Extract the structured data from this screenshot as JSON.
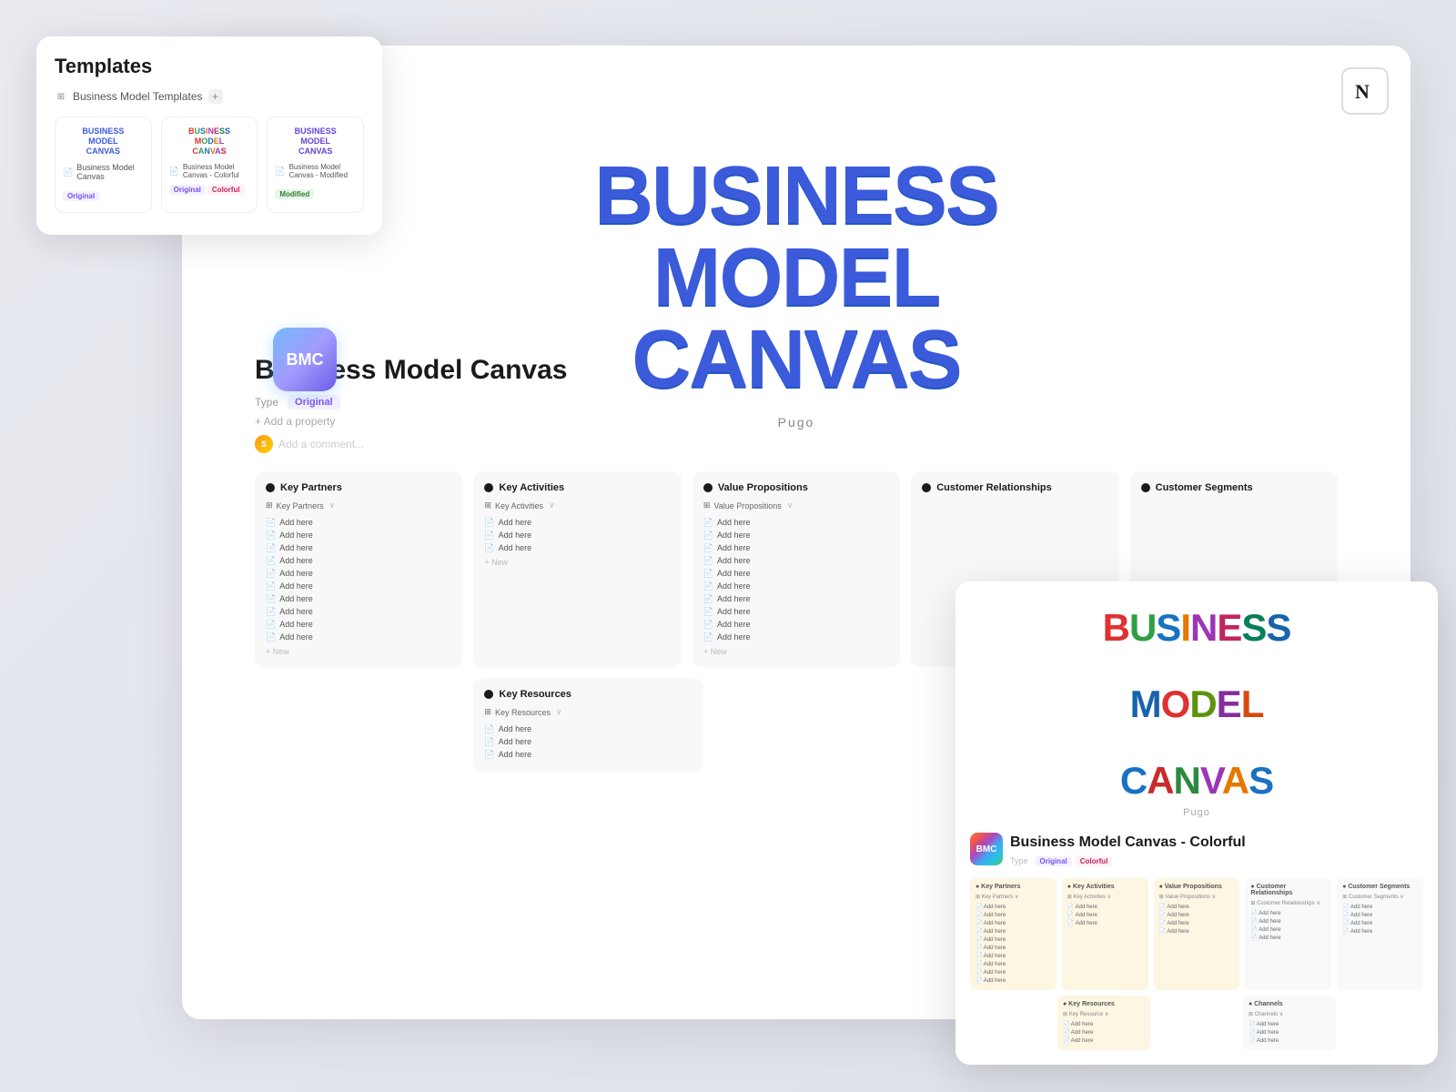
{
  "templates_panel": {
    "title": "Templates",
    "breadcrumb": {
      "icon": "⊞",
      "text": "Business Model Templates",
      "plus": "+"
    },
    "cards": [
      {
        "id": "original",
        "title_lines": [
          "BUSINESS",
          "MODEL",
          "CANVAS"
        ],
        "title_class": "title-original",
        "name": "Business Model Canvas",
        "badge": "Original",
        "badge_class": "badge-original"
      },
      {
        "id": "colorful",
        "title_lines": [
          "BUSINESS",
          "MODEL",
          "CANVAS"
        ],
        "title_class": "title-colorful",
        "name": "Business Model Canvas - Colorful",
        "badge1": "Original",
        "badge1_class": "badge-original",
        "badge2": "Colorful",
        "badge2_class": "badge-colorful"
      },
      {
        "id": "modified",
        "title_lines": [
          "BUSINESS",
          "MODEL",
          "CANVAS"
        ],
        "title_class": "title-modified",
        "name": "Business Model Canvas - Modified",
        "badge": "Modified",
        "badge_class": "badge-modified"
      }
    ]
  },
  "hero": {
    "title_line1": "BUSINESS",
    "title_line2": "MODEL",
    "title_line3": "CANVAS",
    "author": "Pugo"
  },
  "page": {
    "bmc_icon_text": "BMC",
    "title": "Business Model Canvas",
    "property_label": "Type",
    "property_value": "Original",
    "add_property": "+ Add a property",
    "add_comment": "Add a comment...",
    "sections": [
      {
        "title": "Key Partners",
        "db_label": "Key Partners",
        "items": [
          "Add here",
          "Add here",
          "Add here",
          "Add here",
          "Add here",
          "Add here",
          "Add here",
          "Add here",
          "Add here",
          "Add here"
        ]
      },
      {
        "title": "Key Activities",
        "db_label": "Key Activities",
        "items": [
          "Add here",
          "Add here",
          "Add here"
        ]
      },
      {
        "title": "Value Propositions",
        "db_label": "Value Propositions",
        "items": [
          "Add here",
          "Add here",
          "Add here",
          "Add here",
          "Add here",
          "Add here",
          "Add here",
          "Add here",
          "Add here",
          "Add here"
        ]
      },
      {
        "title": "Customer Relationships",
        "db_label": "Customer Relationships",
        "items": []
      },
      {
        "title": "Customer Segments",
        "db_label": "Customer Segments",
        "items": []
      }
    ],
    "bottom_sections": [
      {
        "title": "Key Resources",
        "db_label": "Key Resources",
        "items": [
          "Add here",
          "Add here",
          "Add here"
        ]
      }
    ]
  },
  "colorful_card": {
    "bmc_icon": "BMC",
    "title": "Business Model Canvas - Colorful",
    "badge1": "Original",
    "badge2": "Colorful",
    "author": "Pugo",
    "mini_sections": [
      {
        "title": "Key Partners",
        "db": "Key Partners",
        "items": [
          "Add here",
          "Add here",
          "Add here",
          "Add here",
          "Add here",
          "Add here",
          "Add here",
          "Add here",
          "Add here",
          "Add here"
        ]
      },
      {
        "title": "Key Activities",
        "db": "Key Activities",
        "items": [
          "Add here",
          "Add here",
          "Add here"
        ]
      },
      {
        "title": "Value Propositions",
        "db": "Value Propositions",
        "items": [
          "Add here",
          "Add here",
          "Add here",
          "Add here"
        ]
      },
      {
        "title": "Customer Relationships",
        "db": "Customer Relationships",
        "items": [
          "Add here",
          "Add here",
          "Add here",
          "Add here"
        ]
      },
      {
        "title": "Customer Segments",
        "db": "Customer Segments",
        "items": [
          "Add here",
          "Add here",
          "Add here",
          "Add here"
        ]
      }
    ],
    "mini_sections2": [
      {
        "title": "Key Resources",
        "db": "Key Resource",
        "items": [
          "Add here",
          "Add here",
          "Add here"
        ]
      },
      {
        "title": "Channels",
        "db": "Channels",
        "items": [
          "Add here",
          "Add here",
          "Add here"
        ]
      }
    ]
  },
  "notion_icon": "N"
}
